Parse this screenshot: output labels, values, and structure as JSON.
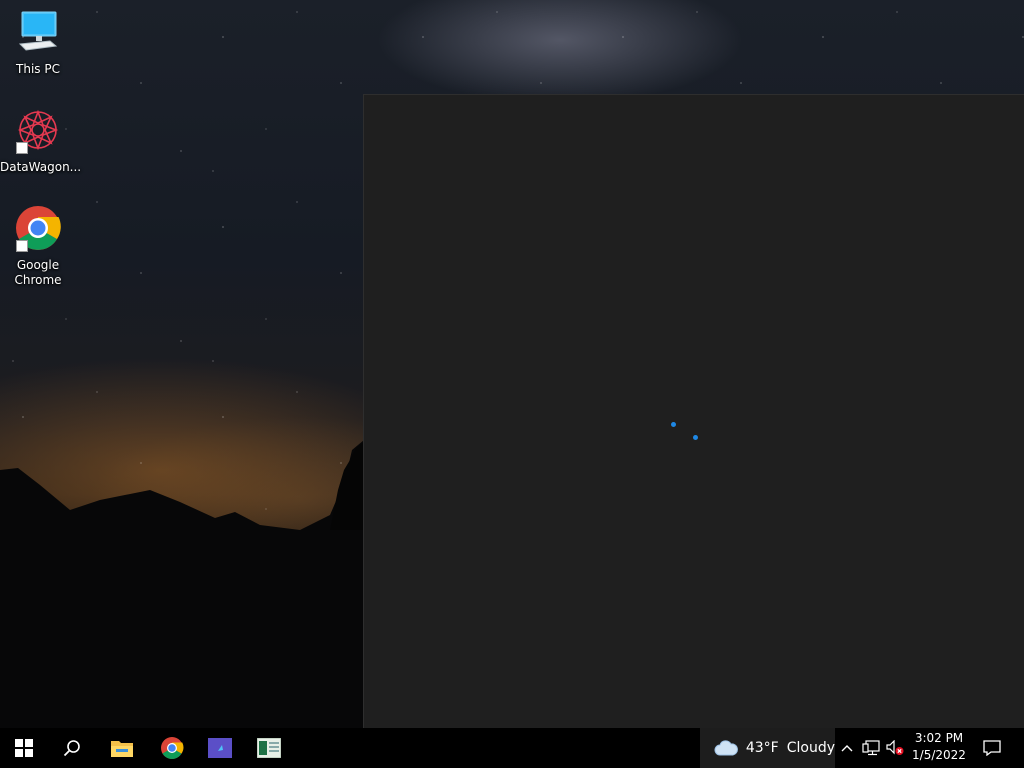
{
  "desktop": {
    "icons": [
      {
        "label": "This PC"
      },
      {
        "label": "DataWagon..."
      },
      {
        "label": "Google Chrome"
      }
    ]
  },
  "taskbar": {
    "weather": {
      "temp": "43°F",
      "condition": "Cloudy"
    },
    "clock": {
      "time": "3:02 PM",
      "date": "1/5/2022"
    }
  },
  "colors": {
    "accent": "#1e88e5",
    "window_bg": "#1f1f1f",
    "taskbar_bg": "#000000"
  }
}
